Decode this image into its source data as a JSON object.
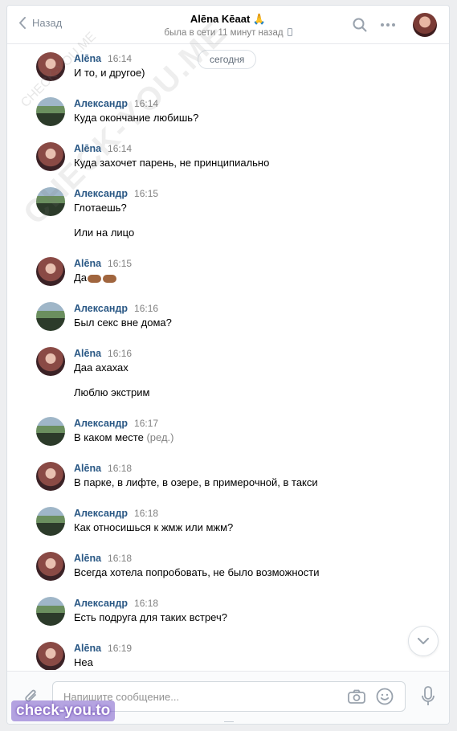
{
  "header": {
    "back_label": "Назад",
    "contact_name": "Alēna Kēaat 🙏",
    "status": "была в сети 11 минут назад"
  },
  "date_divider": "сегодня",
  "messages": [
    {
      "author": "Alēna",
      "time": "16:14",
      "lines": [
        "И то, и другое)"
      ]
    },
    {
      "author": "Александр",
      "time": "16:14",
      "lines": [
        "Куда окончание любишь?"
      ]
    },
    {
      "author": "Alēna",
      "time": "16:14",
      "lines": [
        "Куда захочет парень, не принципиально"
      ]
    },
    {
      "author": "Александр",
      "time": "16:15",
      "lines": [
        "Глотаешь?",
        "Или на лицо"
      ]
    },
    {
      "author": "Alēna",
      "time": "16:15",
      "lines": [
        "Да"
      ],
      "emoji": "pointing-hands"
    },
    {
      "author": "Александр",
      "time": "16:16",
      "lines": [
        "Был секс вне дома?"
      ]
    },
    {
      "author": "Alēna",
      "time": "16:16",
      "lines": [
        "Даа ахахах",
        "Люблю экстрим"
      ]
    },
    {
      "author": "Александр",
      "time": "16:17",
      "lines": [
        "В каком месте"
      ],
      "edited": "(ред.)"
    },
    {
      "author": "Alēna",
      "time": "16:18",
      "lines": [
        "В парке, в лифте, в озере, в примерочной, в такси"
      ]
    },
    {
      "author": "Александр",
      "time": "16:18",
      "lines": [
        "Как относишься к жмж или мжм?"
      ]
    },
    {
      "author": "Alēna",
      "time": "16:18",
      "lines": [
        "Всегда хотела попробовать, не было возможности"
      ]
    },
    {
      "author": "Александр",
      "time": "16:18",
      "lines": [
        "Есть подруга для таких встреч?"
      ]
    },
    {
      "author": "Alēna",
      "time": "16:19",
      "lines": [
        "Неа"
      ]
    }
  ],
  "composer": {
    "placeholder": "Напишите сообщение..."
  },
  "watermarks": {
    "diagonal": "CHECK-YOU.ME",
    "small": "CHECK-YOU.ME",
    "badge": "check-you.to"
  },
  "colors": {
    "author_link": "#2a5885",
    "time_gray": "#828282",
    "background": "#edeef0"
  }
}
